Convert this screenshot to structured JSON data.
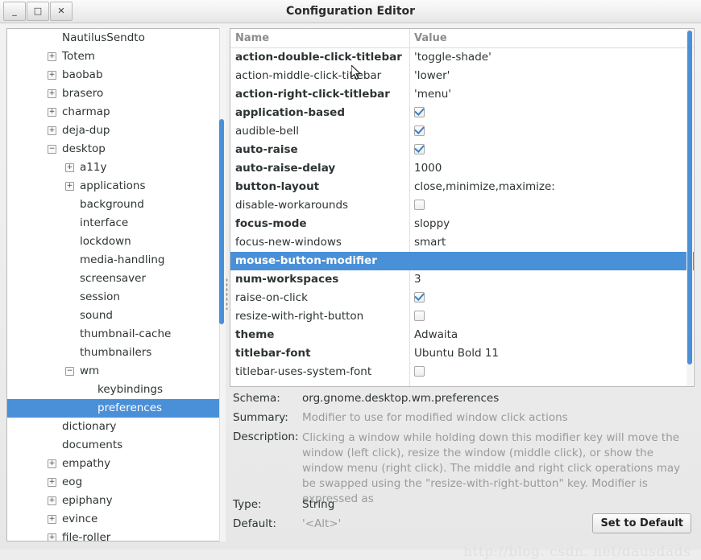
{
  "window": {
    "title": "Configuration Editor",
    "buttons": [
      {
        "name": "minimize",
        "glyph": "_"
      },
      {
        "name": "maximize",
        "glyph": "□"
      },
      {
        "name": "close",
        "glyph": "✕"
      }
    ]
  },
  "tree": {
    "items": [
      {
        "label": "NautilusSendto",
        "depth": 1,
        "expander": "none",
        "selected": false
      },
      {
        "label": "Totem",
        "depth": 1,
        "expander": "plus",
        "selected": false
      },
      {
        "label": "baobab",
        "depth": 1,
        "expander": "plus",
        "selected": false
      },
      {
        "label": "brasero",
        "depth": 1,
        "expander": "plus",
        "selected": false
      },
      {
        "label": "charmap",
        "depth": 1,
        "expander": "plus",
        "selected": false
      },
      {
        "label": "deja-dup",
        "depth": 1,
        "expander": "plus",
        "selected": false
      },
      {
        "label": "desktop",
        "depth": 1,
        "expander": "minus",
        "selected": false
      },
      {
        "label": "a11y",
        "depth": 2,
        "expander": "plus",
        "selected": false
      },
      {
        "label": "applications",
        "depth": 2,
        "expander": "plus",
        "selected": false
      },
      {
        "label": "background",
        "depth": 2,
        "expander": "none",
        "selected": false
      },
      {
        "label": "interface",
        "depth": 2,
        "expander": "none",
        "selected": false
      },
      {
        "label": "lockdown",
        "depth": 2,
        "expander": "none",
        "selected": false
      },
      {
        "label": "media-handling",
        "depth": 2,
        "expander": "none",
        "selected": false
      },
      {
        "label": "screensaver",
        "depth": 2,
        "expander": "none",
        "selected": false
      },
      {
        "label": "session",
        "depth": 2,
        "expander": "none",
        "selected": false
      },
      {
        "label": "sound",
        "depth": 2,
        "expander": "none",
        "selected": false
      },
      {
        "label": "thumbnail-cache",
        "depth": 2,
        "expander": "none",
        "selected": false
      },
      {
        "label": "thumbnailers",
        "depth": 2,
        "expander": "none",
        "selected": false
      },
      {
        "label": "wm",
        "depth": 2,
        "expander": "minus",
        "selected": false
      },
      {
        "label": "keybindings",
        "depth": 3,
        "expander": "none",
        "selected": false
      },
      {
        "label": "preferences",
        "depth": 3,
        "expander": "none",
        "selected": true
      },
      {
        "label": "dictionary",
        "depth": 1,
        "expander": "none",
        "selected": false
      },
      {
        "label": "documents",
        "depth": 1,
        "expander": "none",
        "selected": false
      },
      {
        "label": "empathy",
        "depth": 1,
        "expander": "plus",
        "selected": false
      },
      {
        "label": "eog",
        "depth": 1,
        "expander": "plus",
        "selected": false
      },
      {
        "label": "epiphany",
        "depth": 1,
        "expander": "plus",
        "selected": false
      },
      {
        "label": "evince",
        "depth": 1,
        "expander": "plus",
        "selected": false
      },
      {
        "label": "file-roller",
        "depth": 1,
        "expander": "plus",
        "selected": false
      }
    ]
  },
  "table": {
    "columns": [
      "Name",
      "Value"
    ],
    "rows": [
      {
        "name": "action-double-click-titlebar",
        "value": "'toggle-shade'",
        "bold": true,
        "type": "text",
        "selected": false
      },
      {
        "name": "action-middle-click-titlebar",
        "value": "'lower'",
        "bold": false,
        "type": "text",
        "selected": false
      },
      {
        "name": "action-right-click-titlebar",
        "value": "'menu'",
        "bold": true,
        "type": "text",
        "selected": false
      },
      {
        "name": "application-based",
        "value": "checked",
        "bold": true,
        "type": "checkbox",
        "selected": false
      },
      {
        "name": "audible-bell",
        "value": "checked",
        "bold": false,
        "type": "checkbox",
        "selected": false
      },
      {
        "name": "auto-raise",
        "value": "checked",
        "bold": true,
        "type": "checkbox",
        "selected": false
      },
      {
        "name": "auto-raise-delay",
        "value": "1000",
        "bold": true,
        "type": "text",
        "selected": false
      },
      {
        "name": "button-layout",
        "value": "close,minimize,maximize:",
        "bold": true,
        "type": "text",
        "selected": false
      },
      {
        "name": "disable-workarounds",
        "value": "unchecked",
        "bold": false,
        "type": "checkbox",
        "selected": false
      },
      {
        "name": "focus-mode",
        "value": "sloppy",
        "bold": true,
        "type": "text",
        "selected": false
      },
      {
        "name": "focus-new-windows",
        "value": "smart",
        "bold": false,
        "type": "text",
        "selected": false
      },
      {
        "name": "mouse-button-modifier",
        "value": "",
        "bold": true,
        "type": "text",
        "selected": true
      },
      {
        "name": "num-workspaces",
        "value": "3",
        "bold": true,
        "type": "text",
        "selected": false
      },
      {
        "name": "raise-on-click",
        "value": "checked",
        "bold": false,
        "type": "checkbox",
        "selected": false
      },
      {
        "name": "resize-with-right-button",
        "value": "unchecked",
        "bold": false,
        "type": "checkbox",
        "selected": false
      },
      {
        "name": "theme",
        "value": "Adwaita",
        "bold": true,
        "type": "text",
        "selected": false
      },
      {
        "name": "titlebar-font",
        "value": "Ubuntu Bold 11",
        "bold": true,
        "type": "text",
        "selected": false
      },
      {
        "name": "titlebar-uses-system-font",
        "value": "unchecked",
        "bold": false,
        "type": "checkbox",
        "selected": false
      }
    ]
  },
  "detail": {
    "schema_label": "Schema:",
    "schema_value": "org.gnome.desktop.wm.preferences",
    "summary_label": "Summary:",
    "summary_value": "Modifier to use for modified window click actions",
    "description_label": "Description:",
    "description_value": "Clicking a window while holding down this modifier key will move the window (left click), resize the window (middle click), or show the window menu (right click). The middle and right click operations may be swapped using the \"resize-with-right-button\" key. Modifier is expressed as",
    "type_label": "Type:",
    "type_value": "String",
    "default_label": "Default:",
    "default_value": "'<Alt>'",
    "set_default_button": "Set to Default"
  },
  "watermark": {
    "text": "http://blog. csdn. net/dausdads"
  },
  "colors": {
    "selection": "#4a90d9",
    "check": "#3b7fc4",
    "dim_text": "#9a9a9a"
  }
}
